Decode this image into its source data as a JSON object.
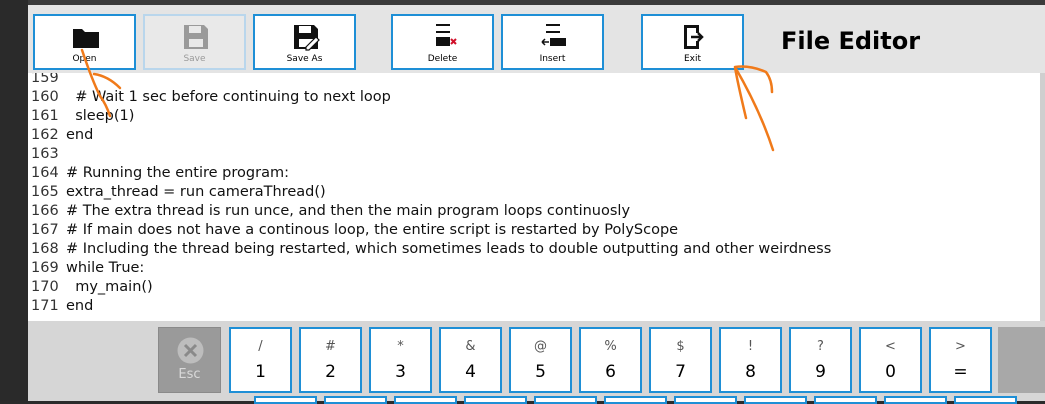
{
  "toolbar": {
    "open_label": "Open",
    "save_label": "Save",
    "save_as_label": "Save As",
    "delete_label": "Delete",
    "insert_label": "Insert",
    "exit_label": "Exit"
  },
  "header": {
    "title": "File Editor"
  },
  "editor": {
    "lines": [
      {
        "num": "159",
        "text": ""
      },
      {
        "num": "160",
        "text": "  # Wait 1 sec before continuing to next loop"
      },
      {
        "num": "161",
        "text": "  sleep(1)"
      },
      {
        "num": "162",
        "text": "end"
      },
      {
        "num": "163",
        "text": ""
      },
      {
        "num": "164",
        "text": "# Running the entire program:"
      },
      {
        "num": "165",
        "text": "extra_thread = run cameraThread()"
      },
      {
        "num": "166",
        "text": "# The extra thread is run unce, and then the main program loops continuosly"
      },
      {
        "num": "167",
        "text": "# If main does not have a continous loop, the entire script is restarted by PolyScope"
      },
      {
        "num": "168",
        "text": "# Including the thread being restarted, which sometimes leads to double outputting and other weirdness"
      },
      {
        "num": "169",
        "text": "while True:"
      },
      {
        "num": "170",
        "text": "  my_main()"
      },
      {
        "num": "171",
        "text": "end"
      }
    ]
  },
  "keyboard": {
    "esc_label": "Esc",
    "keys": [
      {
        "shift": "/",
        "main": "1"
      },
      {
        "shift": "#",
        "main": "2"
      },
      {
        "shift": "*",
        "main": "3"
      },
      {
        "shift": "&",
        "main": "4"
      },
      {
        "shift": "@",
        "main": "5"
      },
      {
        "shift": "%",
        "main": "6"
      },
      {
        "shift": "$",
        "main": "7"
      },
      {
        "shift": "!",
        "main": "8"
      },
      {
        "shift": "?",
        "main": "9"
      },
      {
        "shift": "<",
        "main": "0"
      },
      {
        "shift": ">",
        "main": "="
      }
    ]
  },
  "colors": {
    "accent": "#1e8fd6",
    "annotation": "#f07a1a"
  }
}
